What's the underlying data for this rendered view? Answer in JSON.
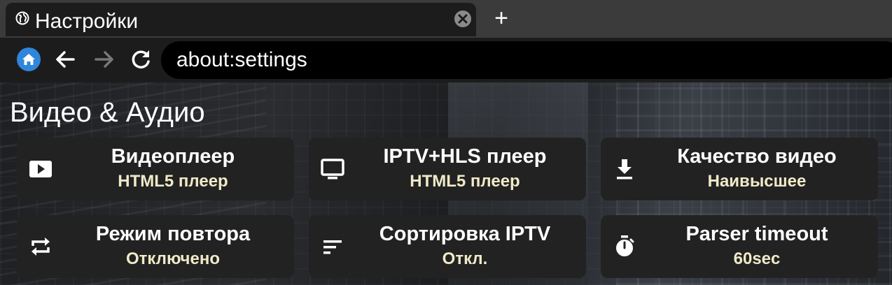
{
  "tab": {
    "title": "Настройки",
    "icon": "globe-icon",
    "close_icon": "close-icon",
    "new_tab_label": "+"
  },
  "toolbar": {
    "home_icon": "home-icon",
    "back_icon": "back-arrow-icon",
    "forward_icon": "forward-arrow-icon",
    "reload_icon": "reload-icon",
    "address": "about:settings"
  },
  "settings": {
    "section_title": "Видео & Аудио",
    "cards": [
      {
        "icon": "play-icon",
        "title": "Видеоплеер",
        "value": "HTML5 плеер"
      },
      {
        "icon": "monitor-icon",
        "title": "IPTV+HLS плеер",
        "value": "HTML5 плеер"
      },
      {
        "icon": "download-icon",
        "title": "Качество видео",
        "value": "Наивысшее"
      },
      {
        "icon": "repeat-icon",
        "title": "Режим повтора",
        "value": "Отключено"
      },
      {
        "icon": "sort-icon",
        "title": "Сортировка IPTV",
        "value": "Откл."
      },
      {
        "icon": "timer-icon",
        "title": "Parser timeout",
        "value": "60sec"
      }
    ]
  },
  "colors": {
    "tab_strip": "#3b3b3b",
    "toolbar": "#1c1c1c",
    "address_bar": "#000000",
    "home_button": "#2f86db",
    "card_background": "#222222",
    "card_value_text": "#f0eac8"
  }
}
